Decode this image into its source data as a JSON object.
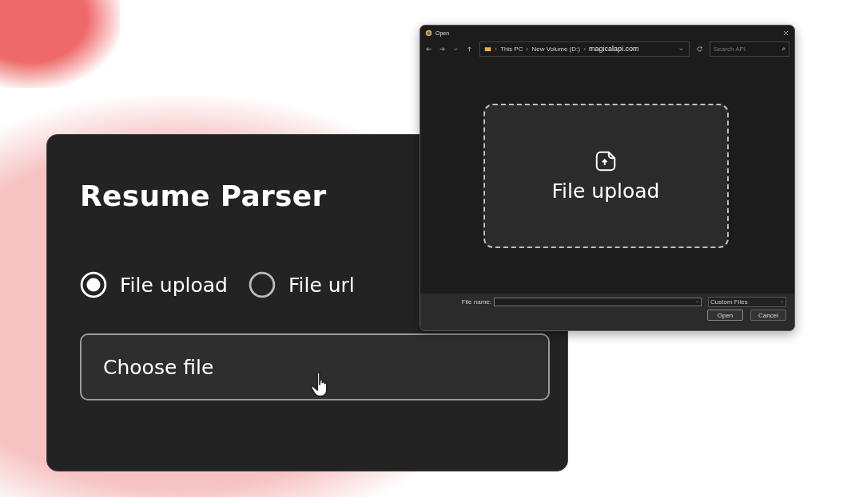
{
  "card": {
    "title": "Resume Parser",
    "options": [
      {
        "label": "File upload",
        "selected": true
      },
      {
        "label": "File url",
        "selected": false
      }
    ],
    "file_button": {
      "label": "Choose file"
    }
  },
  "dialog": {
    "title": "Open",
    "breadcrumb": [
      "This PC",
      "New Volume (D:)",
      "magicalapi.com"
    ],
    "search": {
      "placeholder": "Search API"
    },
    "drop_zone": {
      "label": "File upload"
    },
    "file_name": {
      "label": "File name:"
    },
    "file_type": "Custom Files",
    "buttons": [
      "Open",
      "Cancel"
    ]
  }
}
